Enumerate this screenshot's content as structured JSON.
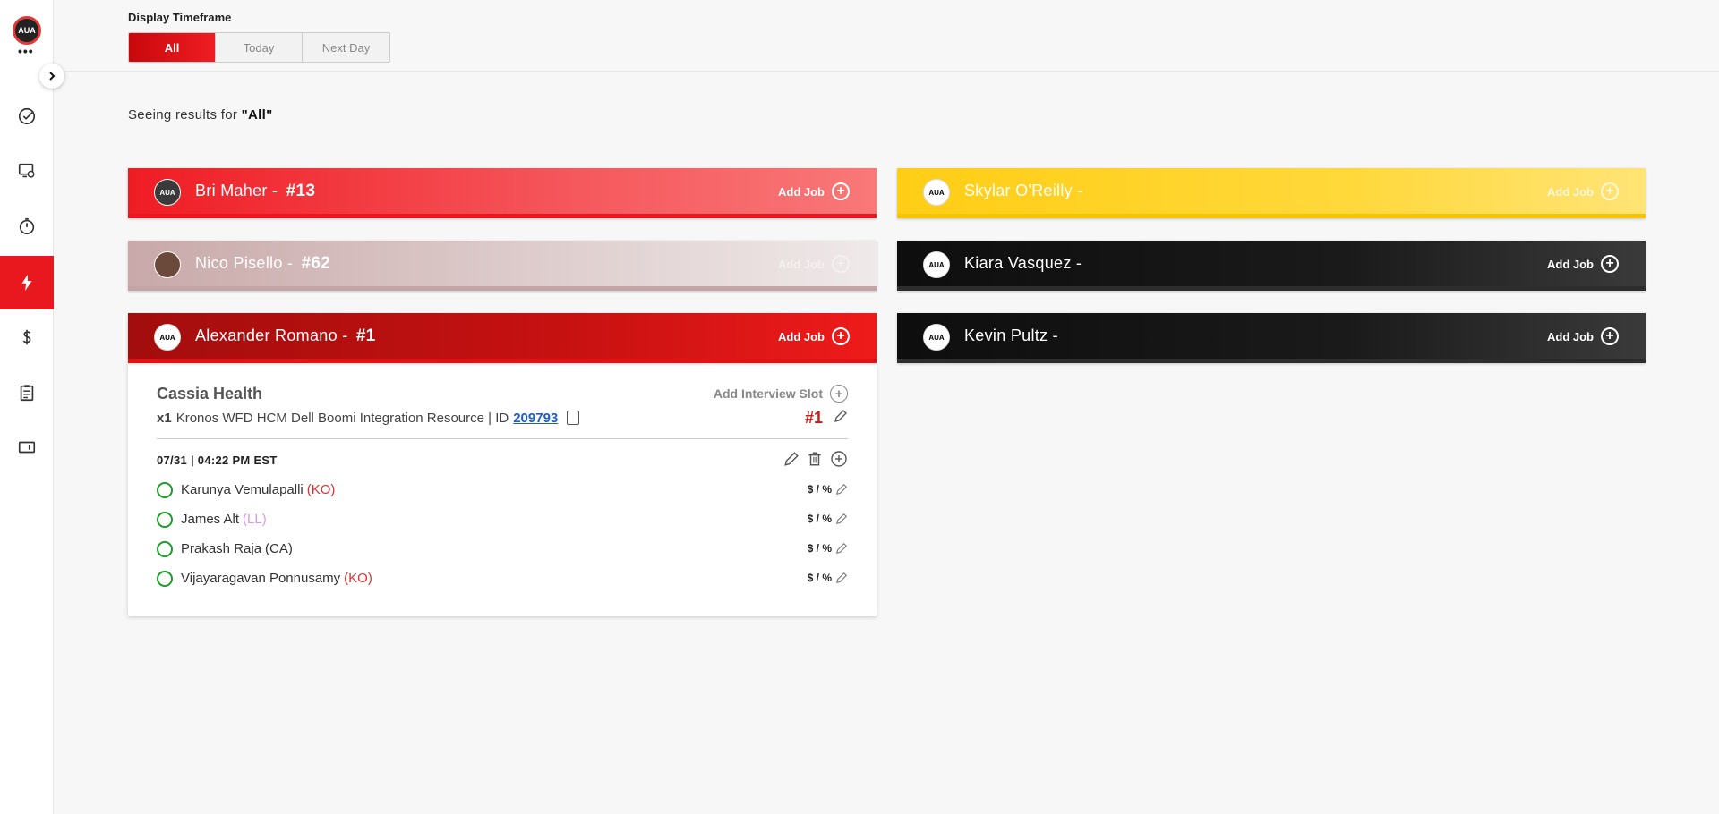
{
  "sidebar": {
    "avatar_text": "AUA",
    "items": [
      "tasks-icon",
      "screen-settings-icon",
      "timer-icon",
      "lightning-icon",
      "dollar-icon",
      "clipboard-icon",
      "book-icon"
    ],
    "active_index": 3
  },
  "timeframe": {
    "label": "Display Timeframe",
    "options": [
      "All",
      "Today",
      "Next Day"
    ],
    "selected": "All"
  },
  "results": {
    "prefix": "Seeing results for ",
    "query": "\"All\""
  },
  "left_column": [
    {
      "name": "Bri Maher -",
      "number": "#13",
      "add_job": "Add Job",
      "color": "#f01c24"
    },
    {
      "name": "Nico Pisello -",
      "number": "#62",
      "add_job": "Add Job",
      "color": "#c9a9a9"
    },
    {
      "name": "Alexander Romano -",
      "number": "#1",
      "add_job": "Add Job",
      "color": "#c81111"
    }
  ],
  "right_column": [
    {
      "name": "Skylar O'Reilly -",
      "add_job": "Add Job",
      "color": "#ffcd14"
    },
    {
      "name": "Kiara Vasquez -",
      "add_job": "Add Job",
      "color": "#1a1a1a"
    },
    {
      "name": "Kevin Pultz -",
      "add_job": "Add Job",
      "color": "#1a1a1a"
    }
  ],
  "job_card": {
    "company": "Cassia Health",
    "add_slot": "Add Interview Slot",
    "quantity": "x1",
    "title": "Kronos WFD HCM Dell Boomi Integration Resource | ID",
    "job_id": "209793",
    "rank": "#1",
    "slot_time": "07/31 | 04:22 PM EST",
    "candidates": [
      {
        "name": "Karunya Vemulapalli",
        "tag": "(KO)",
        "tag_color": "#e03030",
        "rate": "$ / %"
      },
      {
        "name": "James Alt",
        "tag": "(LL)",
        "tag_color": "#d89ae0",
        "rate": "$ / %"
      },
      {
        "name": "Prakash Raja",
        "tag": "(CA)",
        "tag_color": "#333333",
        "rate": "$ / %"
      },
      {
        "name": "Vijayaragavan Ponnusamy",
        "tag": "(KO)",
        "tag_color": "#e03030",
        "rate": "$ / %"
      }
    ]
  }
}
